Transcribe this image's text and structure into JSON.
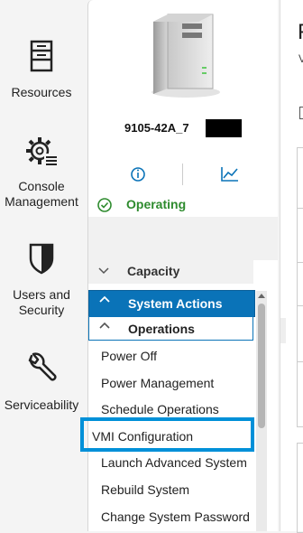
{
  "nav": {
    "items": [
      {
        "label": "Resources",
        "icon": "server-rack-icon"
      },
      {
        "label": "Console Management",
        "icon": "gear-console-icon"
      },
      {
        "label": "Users and Security",
        "icon": "shield-icon"
      },
      {
        "label": "Serviceability",
        "icon": "wrench-icon"
      }
    ]
  },
  "system": {
    "name": "9105-42A_7",
    "status": "Operating"
  },
  "tabs": [
    "info-icon",
    "chart-icon"
  ],
  "accordion": {
    "capacity": "Capacity",
    "system_actions": "System Actions",
    "operations": "Operations"
  },
  "operations_menu": [
    "Power Off",
    "Power Management",
    "Schedule Operations",
    "VMI Configuration",
    "Launch Advanced System",
    "Rebuild System",
    "Change System Password"
  ],
  "right_panel": {
    "title": "F",
    "subtitle": "V"
  },
  "colors": {
    "accent": "#0a73b8",
    "status_green": "#2e8b2e",
    "highlight": "#0090d8"
  }
}
